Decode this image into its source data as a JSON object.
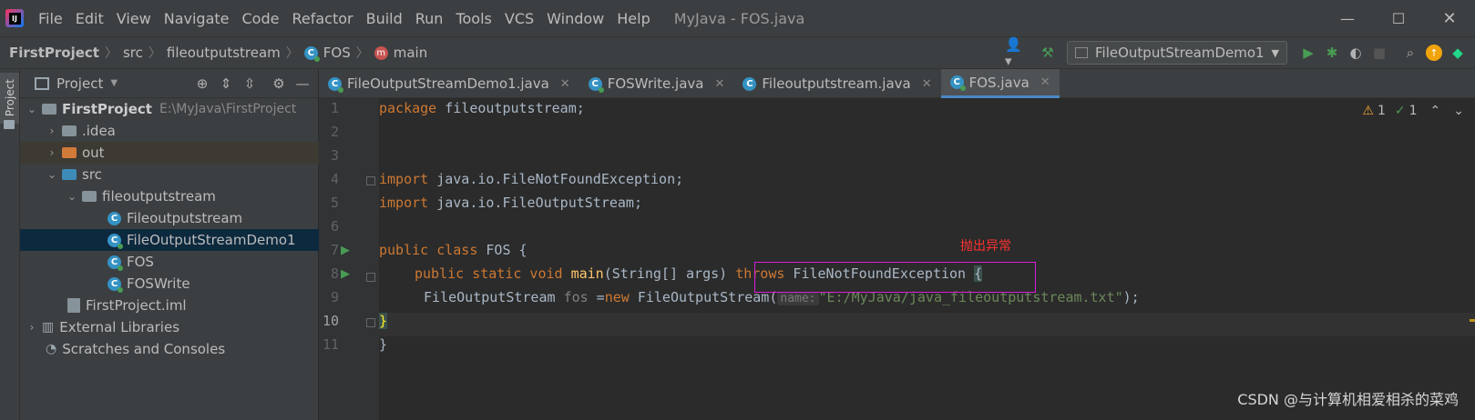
{
  "menu": {
    "items": [
      "File",
      "Edit",
      "View",
      "Navigate",
      "Code",
      "Refactor",
      "Build",
      "Run",
      "Tools",
      "VCS",
      "Window",
      "Help"
    ],
    "title": "MyJava - FOS.java"
  },
  "breadcrumb": [
    "FirstProject",
    "src",
    "fileoutputstream",
    "FOS",
    "main"
  ],
  "run_config": "FileOutputStreamDemo1",
  "project_panel": {
    "title": "Project",
    "tree": [
      {
        "label": "FirstProject",
        "path": "E:\\MyJava\\FirstProject",
        "icon": "folder-icon"
      },
      {
        "label": ".idea",
        "icon": "folder-icon"
      },
      {
        "label": "out",
        "icon": "folder-orange-icon"
      },
      {
        "label": "src",
        "icon": "folder-blue-icon"
      },
      {
        "label": "fileoutputstream",
        "icon": "package-icon"
      },
      {
        "label": "Fileoutputstream",
        "icon": "class-icon"
      },
      {
        "label": "FileOutputStreamDemo1",
        "icon": "class-run-icon"
      },
      {
        "label": "FOS",
        "icon": "class-run-icon"
      },
      {
        "label": "FOSWrite",
        "icon": "class-run-icon"
      },
      {
        "label": "FirstProject.iml",
        "icon": "module-file-icon"
      },
      {
        "label": "External Libraries",
        "icon": "library-icon"
      },
      {
        "label": "Scratches and Consoles",
        "icon": "scratch-icon"
      }
    ]
  },
  "side_stripe": {
    "label": "Project"
  },
  "tabs": [
    {
      "label": "FileOutputStreamDemo1.java",
      "active": false
    },
    {
      "label": "FOSWrite.java",
      "active": false
    },
    {
      "label": "Fileoutputstream.java",
      "active": false
    },
    {
      "label": "FOS.java",
      "active": true
    }
  ],
  "inspections": {
    "warnings": "1",
    "ok": "1"
  },
  "code": {
    "line_numbers": [
      "1",
      "2",
      "3",
      "4",
      "5",
      "6",
      "7",
      "8",
      "9",
      "10",
      "11"
    ],
    "l1_kw": "package",
    "l1_rest": " fileoutputstream;",
    "l4_kw": "import",
    "l4_rest": " java.io.FileNotFoundException;",
    "l5_kw": "import",
    "l5_rest": " java.io.FileOutputStream;",
    "l7_kw": "public class",
    "l7_rest": " FOS {",
    "l8_kw": "public static void",
    "l8_fn": "main",
    "l8_args": "(String[] args) ",
    "l8_throws": "throws",
    "l8_exc": " FileNotFoundException ",
    "l8_brace": "{",
    "l9_pre": " FileOutputStream ",
    "l9_var": "fos",
    "l9_eq": " =",
    "l9_new": "new",
    "l9_cls": " FileOutputStream(",
    "l9_hint": "name:",
    "l9_str": "\"E:/MyJava/java_fileoutputstream.txt\"",
    "l9_end": ");",
    "l10": "}",
    "l11": "}"
  },
  "annotation": {
    "text": "抛出异常",
    "color": "#ff3030",
    "box_color": "#d81dd8"
  },
  "watermark": "CSDN @与计算机相爱相杀的菜鸡",
  "colors": {
    "accent": "#4a88c7",
    "run_green": "#499c54",
    "keyword": "#cc7832",
    "string": "#6a8759",
    "function": "#ffc66d"
  }
}
